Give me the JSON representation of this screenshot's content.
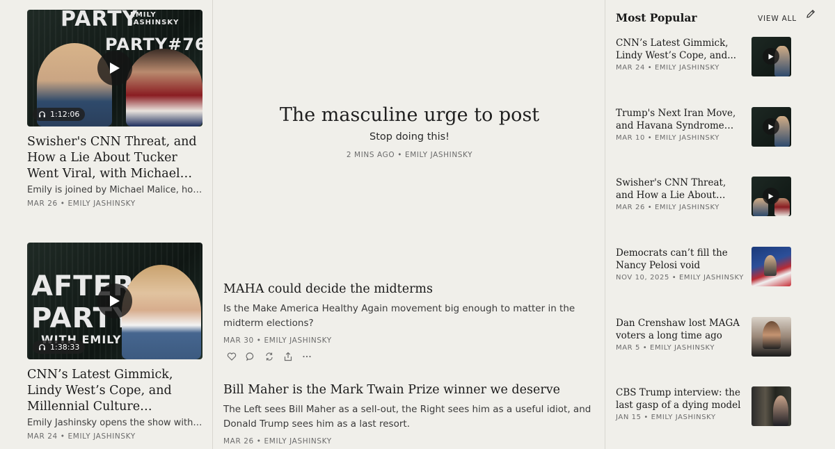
{
  "left_cards": [
    {
      "thumb_word": "PARTY",
      "thumb_word2": "PARTY#76",
      "thumb_brand": "EMILY JASHINSKY",
      "duration": "1:12:06",
      "title": "Swisher's CNN Threat, and How a Lie About Tucker Went Viral, with Michael Malice, PLUS...",
      "subtitle": "Emily is joined by Michael Malice, host of...",
      "date": "MAR 26",
      "author": "EMILY JASHINSKY"
    },
    {
      "thumb_word": "AFTER",
      "thumb_word2": "PARTY",
      "thumb_brand": "WITH EMILY",
      "duration": "1:38:33",
      "title": "CNN’s Latest Gimmick, Lindy West’s Cope, and Millennial Culture Implodes, PLUS...",
      "subtitle": "Emily Jashinsky opens the show with a...",
      "date": "MAR 24",
      "author": "EMILY JASHINSKY"
    }
  ],
  "hero": {
    "title": "The masculine urge to post",
    "subtitle": "Stop doing this!",
    "date": "2 MINS AGO",
    "author": "EMILY JASHINSKY"
  },
  "posts": [
    {
      "title": "MAHA could decide the midterms",
      "subtitle": "Is the Make America Healthy Again movement big enough to matter in the midterm elections?",
      "date": "MAR 30",
      "author": "EMILY JASHINSKY"
    },
    {
      "title": "Bill Maher is the Mark Twain Prize winner we deserve",
      "subtitle": "The Left sees Bill Maher as a sell-out, the Right sees him as a useful idiot, and Donald Trump sees him as a last resort.",
      "date": "MAR 26",
      "author": "EMILY JASHINSKY"
    }
  ],
  "sidebar": {
    "header": "Most Popular",
    "view_all": "VIEW ALL",
    "items": [
      {
        "title": "CNN’s Latest Gimmick, Lindy West’s Cope, and...",
        "date": "MAR 24",
        "author": "EMILY JASHINSKY",
        "has_play": true
      },
      {
        "title": "Trump's Next Iran Move, and Havana Syndrome Cover-U...",
        "date": "MAR 10",
        "author": "EMILY JASHINSKY",
        "has_play": true
      },
      {
        "title": "Swisher's CNN Threat, and How a Lie About Tucker...",
        "date": "MAR 26",
        "author": "EMILY JASHINSKY",
        "has_play": true
      },
      {
        "title": "Democrats can’t fill the Nancy Pelosi void",
        "date": "NOV 10, 2025",
        "author": "EMILY JASHINSKY",
        "has_play": false
      },
      {
        "title": "Dan Crenshaw lost MAGA voters a long time ago",
        "date": "MAR 5",
        "author": "EMILY JASHINSKY",
        "has_play": false
      },
      {
        "title": "CBS Trump interview: the last gasp of a dying model",
        "date": "JAN 15",
        "author": "EMILY JASHINSKY",
        "has_play": false
      }
    ]
  },
  "meta_separator": "•",
  "colors": {
    "background": "#f0efea",
    "divider": "#d8d6d0",
    "meta": "#6b6b6b"
  }
}
